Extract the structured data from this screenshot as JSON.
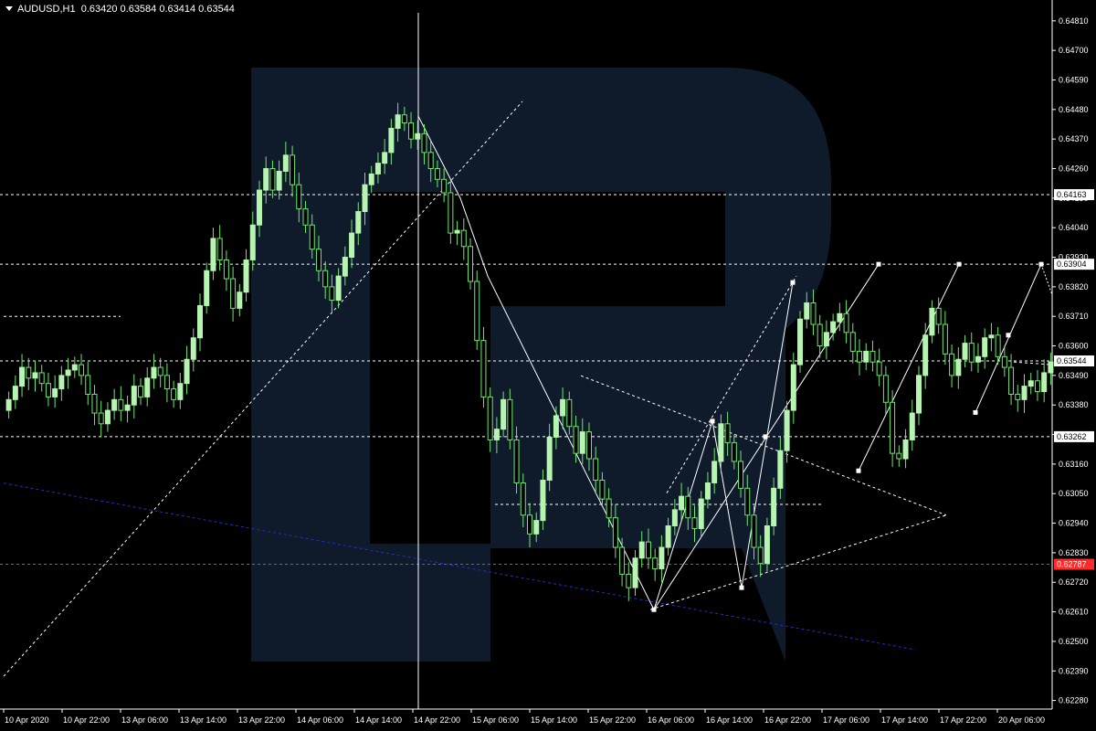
{
  "header": {
    "symbol": "AUDUSD,H1",
    "ohlc": "0.63420 0.63584 0.63414 0.63544"
  },
  "colors": {
    "background": "#000000",
    "bull_candle": "#b6f5b0",
    "bear_candle": "#000000",
    "wick": "#6ee86e",
    "axis_text": "#ffffff",
    "level_line": "#ffffff",
    "red_level": "#ff2b2b",
    "trend_blue": "#2030c8",
    "watermark": "#0f1a2b"
  },
  "chart_data": {
    "type": "candlestick",
    "ylim": [
      0.62248,
      0.6484
    ],
    "y_ticks": [
      "0.64810",
      "0.64700",
      "0.64590",
      "0.64480",
      "0.64370",
      "0.64260",
      "0.64150",
      "0.64040",
      "0.63930",
      "0.63820",
      "0.63710",
      "0.63600",
      "0.63490",
      "0.63380",
      "0.63270",
      "0.63160",
      "0.63050",
      "0.62940",
      "0.62830",
      "0.62720",
      "0.62610",
      "0.62500",
      "0.62390",
      "0.62280"
    ],
    "x_ticks": [
      "10 Apr 2020",
      "10 Apr 22:00",
      "13 Apr 06:00",
      "13 Apr 14:00",
      "13 Apr 22:00",
      "14 Apr 06:00",
      "14 Apr 14:00",
      "14 Apr 22:00",
      "15 Apr 06:00",
      "15 Apr 14:00",
      "15 Apr 22:00",
      "16 Apr 06:00",
      "16 Apr 14:00",
      "16 Apr 22:00",
      "17 Apr 06:00",
      "17 Apr 14:00",
      "17 Apr 22:00",
      "20 Apr 06:00"
    ],
    "price_labels": [
      {
        "text": "0.64163",
        "value": 0.64163,
        "style": "white"
      },
      {
        "text": "0.63904",
        "value": 0.63904,
        "style": "white"
      },
      {
        "text": "0.63544",
        "value": 0.63544,
        "style": "white"
      },
      {
        "text": "0.63262",
        "value": 0.63262,
        "style": "white"
      },
      {
        "text": "0.62787",
        "value": 0.62787,
        "style": "red"
      }
    ],
    "close_series": [
      0.634,
      0.6345,
      0.6352,
      0.6348,
      0.635,
      0.6346,
      0.6341,
      0.6344,
      0.6349,
      0.6351,
      0.6353,
      0.6349,
      0.6342,
      0.6335,
      0.6331,
      0.6336,
      0.634,
      0.6336,
      0.6338,
      0.6345,
      0.6341,
      0.6348,
      0.6352,
      0.6349,
      0.6344,
      0.634,
      0.6346,
      0.6355,
      0.6363,
      0.6375,
      0.6388,
      0.64,
      0.6392,
      0.6385,
      0.6374,
      0.638,
      0.6392,
      0.6405,
      0.6418,
      0.6426,
      0.6418,
      0.6425,
      0.6431,
      0.642,
      0.6411,
      0.6405,
      0.6396,
      0.6388,
      0.6382,
      0.6377,
      0.6386,
      0.6393,
      0.6402,
      0.641,
      0.642,
      0.6424,
      0.6428,
      0.6432,
      0.6441,
      0.6446,
      0.6443,
      0.6437,
      0.6439,
      0.6432,
      0.6426,
      0.6422,
      0.6417,
      0.6402,
      0.6403,
      0.6397,
      0.6384,
      0.6362,
      0.6341,
      0.6325,
      0.6329,
      0.634,
      0.6325,
      0.6309,
      0.6297,
      0.629,
      0.6295,
      0.631,
      0.6326,
      0.6334,
      0.634,
      0.633,
      0.632,
      0.6328,
      0.6318,
      0.631,
      0.6303,
      0.6296,
      0.6285,
      0.6275,
      0.627,
      0.6281,
      0.6287,
      0.6281,
      0.6277,
      0.6285,
      0.6293,
      0.6299,
      0.6304,
      0.6296,
      0.6292,
      0.6303,
      0.6309,
      0.6317,
      0.6331,
      0.6324,
      0.6317,
      0.6307,
      0.6297,
      0.6285,
      0.6279,
      0.6293,
      0.6307,
      0.6321,
      0.6336,
      0.6353,
      0.637,
      0.6376,
      0.6368,
      0.636,
      0.6365,
      0.6369,
      0.6372,
      0.6365,
      0.6358,
      0.6354,
      0.6358,
      0.6354,
      0.6349,
      0.6339,
      0.632,
      0.6318,
      0.6325,
      0.6335,
      0.6349,
      0.6364,
      0.6374,
      0.6368,
      0.6357,
      0.6349,
      0.6355,
      0.6361,
      0.6354,
      0.6356,
      0.6363,
      0.6364,
      0.6356,
      0.6352,
      0.6342,
      0.634,
      0.6345,
      0.6347,
      0.6343,
      0.635,
      0.6354
    ]
  }
}
